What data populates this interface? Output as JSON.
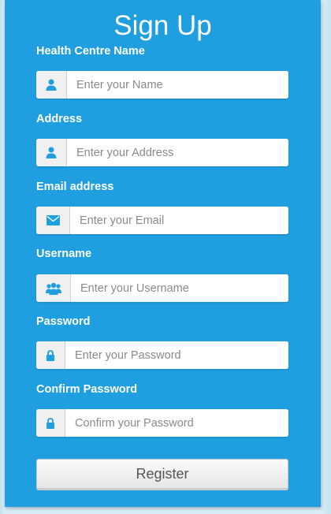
{
  "form": {
    "title": "Sign Up",
    "fields": [
      {
        "label": "Health Centre Name",
        "placeholder": "Enter your Name",
        "value": "",
        "icon": "user-icon"
      },
      {
        "label": "Address",
        "placeholder": "Enter your Address",
        "value": "",
        "icon": "user-icon"
      },
      {
        "label": "Email address",
        "placeholder": "Enter your Email",
        "value": "",
        "icon": "envelope-icon"
      },
      {
        "label": "Username",
        "placeholder": "Enter your Username",
        "value": "",
        "icon": "users-icon"
      },
      {
        "label": "Password",
        "placeholder": "Enter your Password",
        "value": "",
        "icon": "lock-icon"
      },
      {
        "label": "Confirm Password",
        "placeholder": "Confirm your Password",
        "value": "",
        "icon": "lock-icon"
      }
    ],
    "register_label": "Register"
  },
  "colors": {
    "panel": "#1f9ee0",
    "icon": "#1f9ee0",
    "label_text": "#ffffff",
    "button_text": "#555555"
  }
}
